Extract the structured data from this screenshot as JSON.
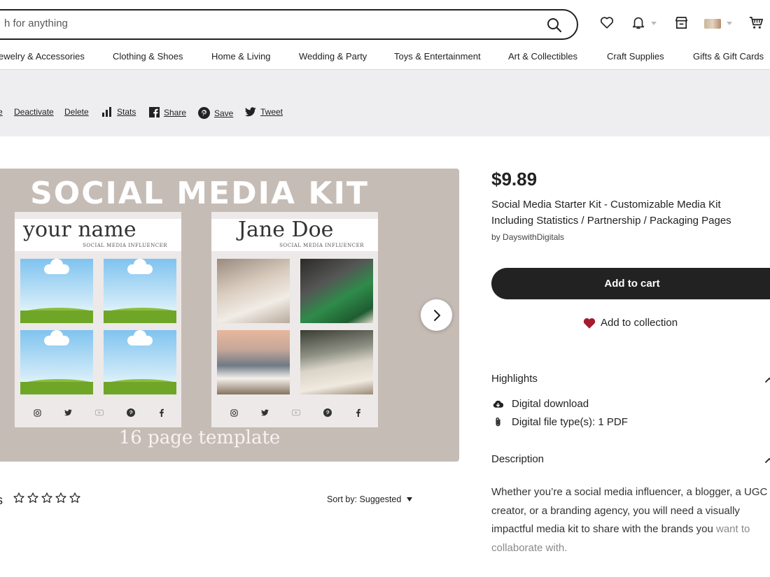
{
  "header": {
    "search_placeholder": "h for anything",
    "icons": [
      "search-icon",
      "heart-icon",
      "bell-icon",
      "shop-icon",
      "avatar",
      "cart-icon"
    ]
  },
  "categories": [
    "ewelry & Accessories",
    "Clothing & Shoes",
    "Home & Living",
    "Wedding & Party",
    "Toys & Entertainment",
    "Art & Collectibles",
    "Craft Supplies",
    "Gifts & Gift Cards"
  ],
  "actions": {
    "fragment": "e",
    "deactivate": "Deactivate",
    "delete": "Delete",
    "stats": "Stats",
    "share": "Share",
    "save": "Save",
    "tweet": "Tweet"
  },
  "image": {
    "title": "SOCIAL MEDIA KIT",
    "card_left_name": "your name",
    "card_right_name": "Jane Doe",
    "card_subtitle": "SOCIAL MEDIA INFLUENCER",
    "footer": "16 page template"
  },
  "reviews": {
    "fragment": "s",
    "rating": 0,
    "sort_label": "Sort by: Suggested"
  },
  "product": {
    "price": "$9.89",
    "title": "Social Media Starter Kit - Customizable Media Kit Including Statistics / Partnership / Packaging Pages",
    "by_prefix": "by",
    "shop": "DayswithDigitals",
    "add_to_cart": "Add to cart",
    "add_to_collection": "Add to collection"
  },
  "highlights": {
    "heading": "Highlights",
    "items": [
      "Digital download",
      "Digital file type(s): 1 PDF"
    ]
  },
  "description": {
    "heading": "Description",
    "text_main": "Whether you’re a social media influencer, a blogger, a UGC creator, or a branding agency, you will need a visually impactful media kit to share with the brands you",
    "text_faded": "want to collaborate with."
  },
  "colors": {
    "accent_heart": "#a61a2e",
    "button_dark": "#222222",
    "action_bar_bg": "#eeedf0",
    "image_bg": "#c6bcb6"
  }
}
